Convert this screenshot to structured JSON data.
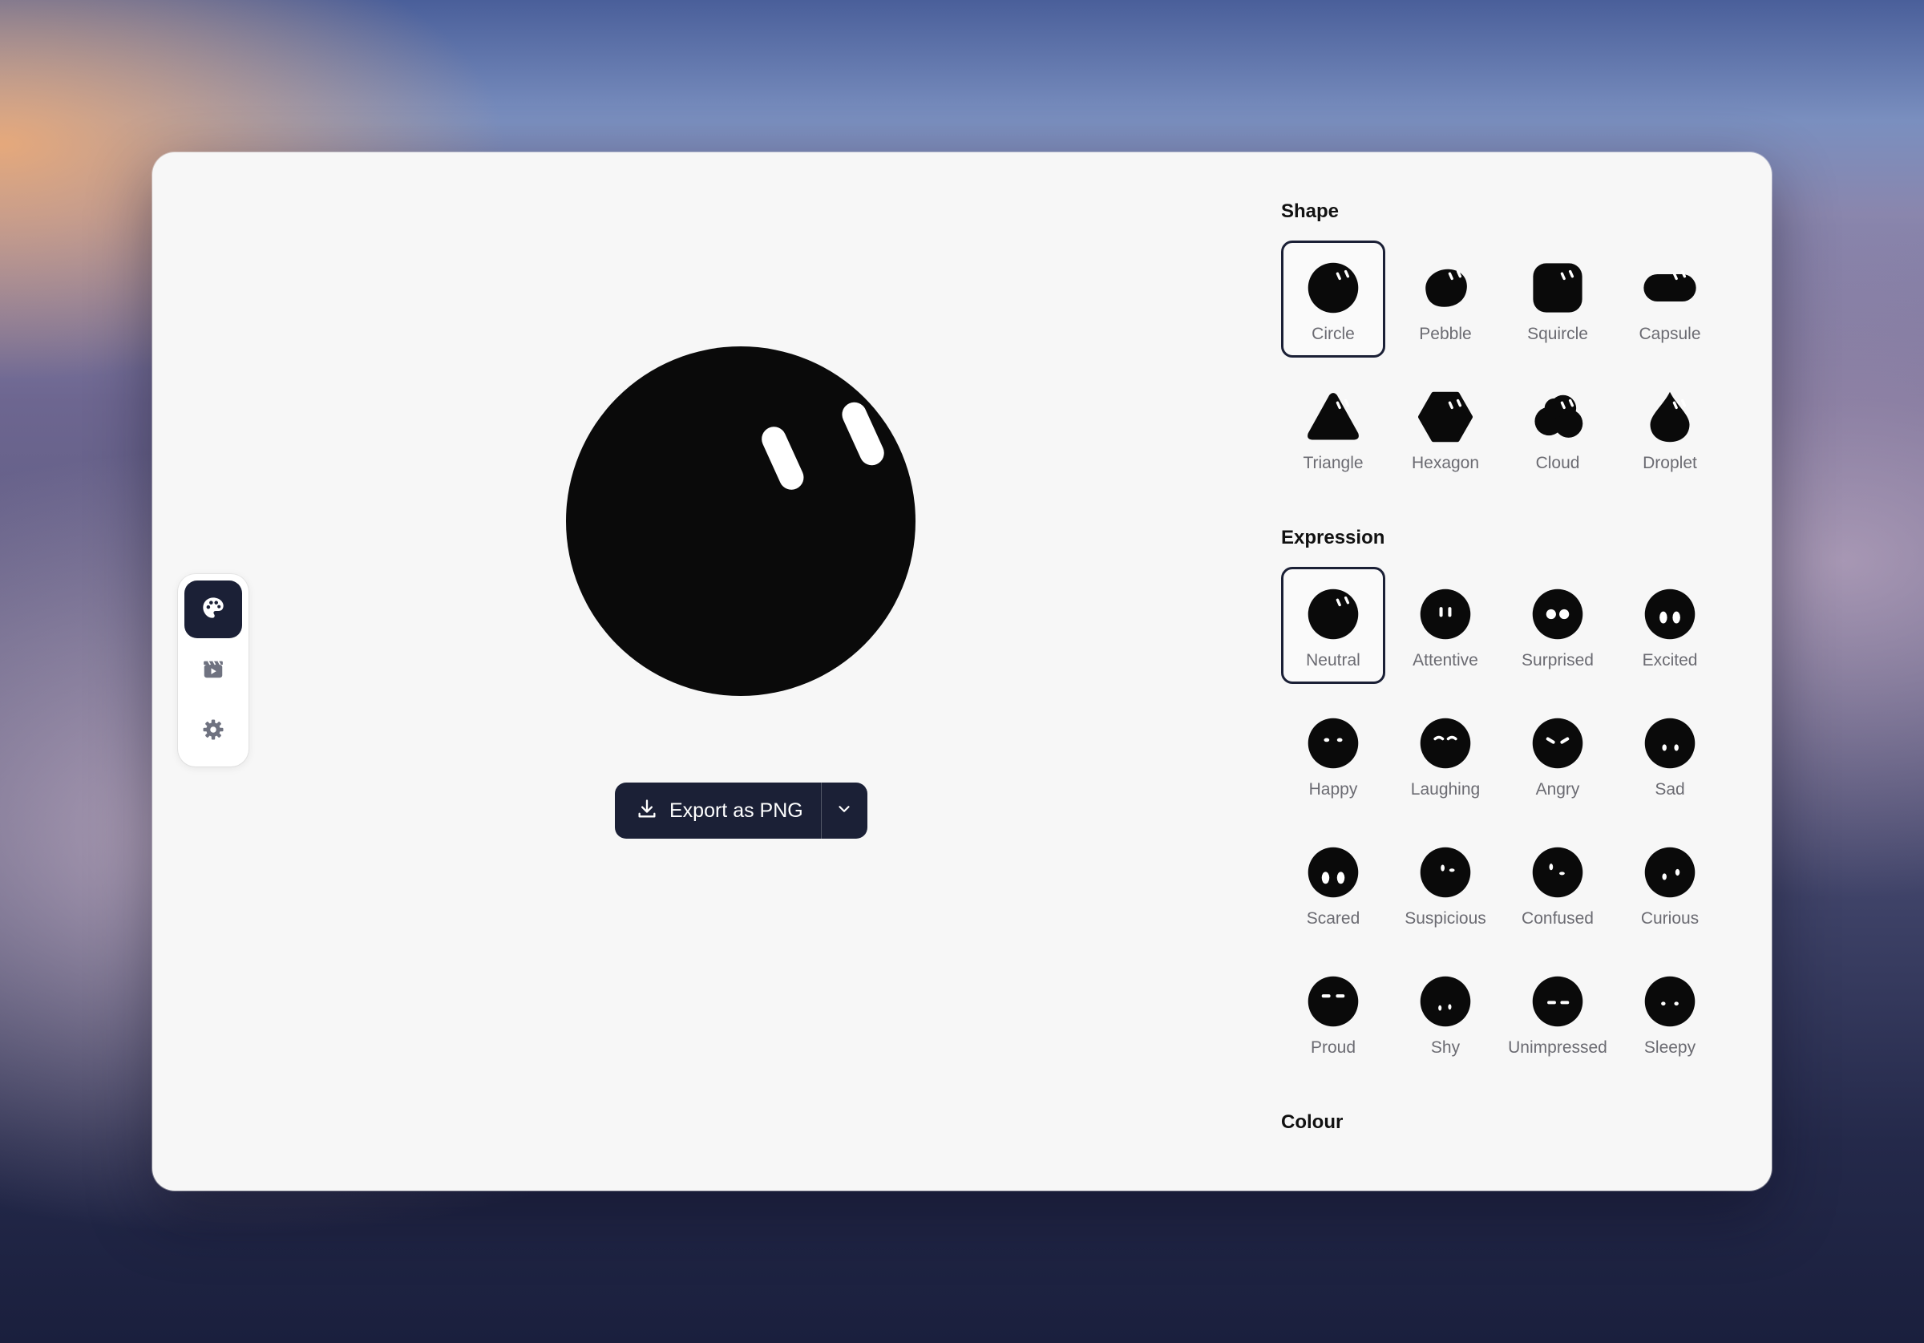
{
  "sidebar": {
    "items": [
      {
        "name": "palette-icon"
      },
      {
        "name": "clapperboard-icon"
      },
      {
        "name": "gear-icon"
      }
    ]
  },
  "preview": {
    "shape": "Circle",
    "expression": "Neutral",
    "colour": "#0a0a0a"
  },
  "export": {
    "label": "Export as PNG",
    "icon": "download-icon",
    "menu_icon": "chevron-down-icon"
  },
  "shape": {
    "title": "Shape",
    "selected": "Circle",
    "items": [
      "Circle",
      "Pebble",
      "Squircle",
      "Capsule",
      "Triangle",
      "Hexagon",
      "Cloud",
      "Droplet"
    ]
  },
  "expression": {
    "title": "Expression",
    "selected": "Neutral",
    "items": [
      "Neutral",
      "Attentive",
      "Surprised",
      "Excited",
      "Happy",
      "Laughing",
      "Angry",
      "Sad",
      "Scared",
      "Suspicious",
      "Confused",
      "Curious",
      "Proud",
      "Shy",
      "Unimpressed",
      "Sleepy"
    ]
  },
  "colour": {
    "title": "Colour",
    "selected": "#0a0a0a",
    "swatches": [
      "#0a0a0a",
      "#7a5a40",
      "#e0474c",
      "#ee9435",
      "#efc12f",
      "#3fc48f"
    ]
  }
}
